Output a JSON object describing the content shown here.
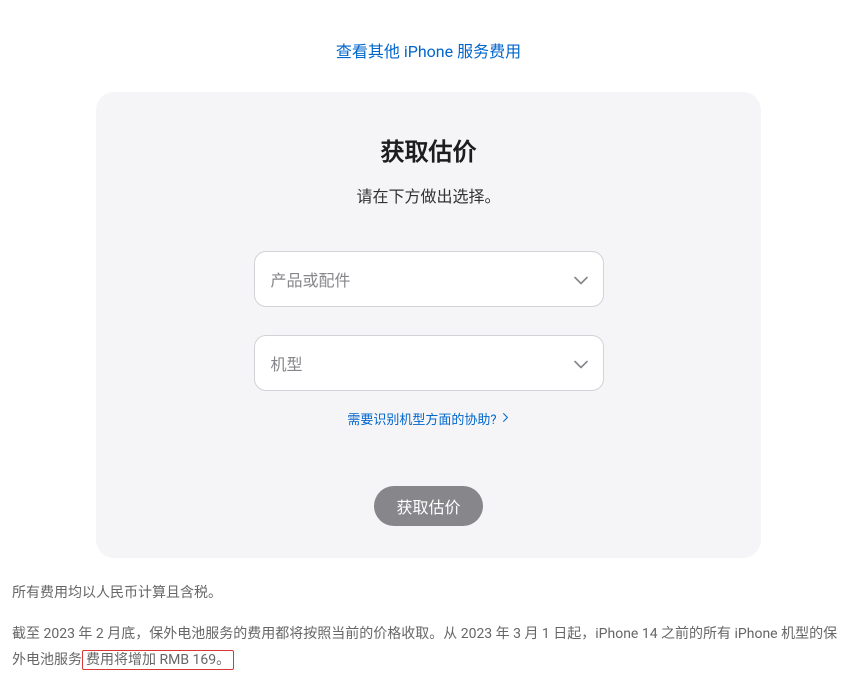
{
  "top_link_label": "查看其他 iPhone 服务费用",
  "card": {
    "title": "获取估价",
    "subtitle": "请在下方做出选择。",
    "product_placeholder": "产品或配件",
    "model_placeholder": "机型",
    "help_link_label": "需要识别机型方面的协助?",
    "submit_label": "获取估价"
  },
  "footer": {
    "line1": "所有费用均以人民币计算且含税。",
    "line2_part1": "截至 2023 年 2 月底，保外电池服务的费用都将按照当前的价格收取。从 2023 年 3 月 1 日起，iPhone 14 之前的所有 iPhone 机型的保外电池服务",
    "line2_highlight": "费用将增加 RMB 169。"
  }
}
